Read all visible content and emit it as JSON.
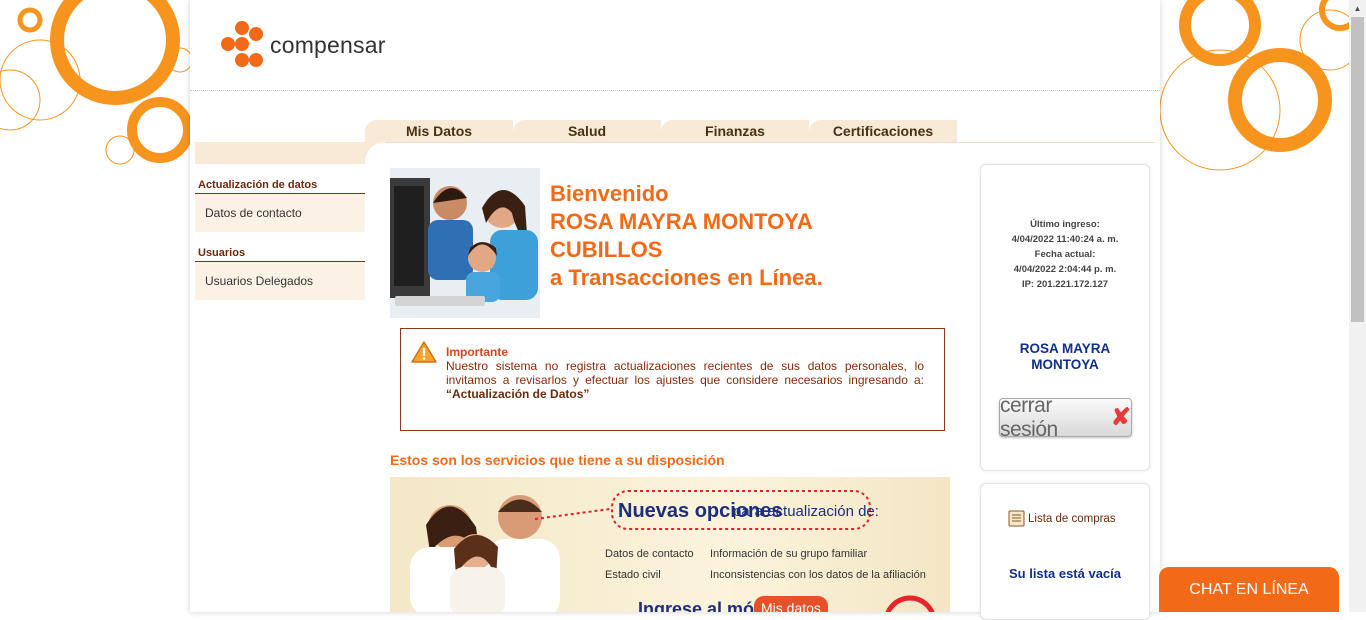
{
  "brand": {
    "name": "compensar",
    "color": "#f26a17"
  },
  "nav": {
    "tabs": [
      "Mis Datos",
      "Salud",
      "Finanzas",
      "Certificaciones"
    ]
  },
  "sidebar": {
    "sections": [
      {
        "heading": "Actualización de datos",
        "items": [
          "Datos de contacto"
        ]
      },
      {
        "heading": "Usuarios",
        "items": [
          "Usuarios Delegados"
        ]
      }
    ]
  },
  "welcome": {
    "line1": "Bienvenido",
    "line2": "ROSA MAYRA MONTOYA",
    "line3": "CUBILLOS",
    "line4": "a Transacciones en Línea."
  },
  "notice": {
    "title": "Importante",
    "body": "Nuestro sistema no registra actualizaciones recientes de sus datos personales, lo invitamos a revisarlos y efectuar los ajustes que considere necesarios ingresando a:",
    "link": "“Actualización de Datos”"
  },
  "services": {
    "title": "Estos son los servicios que tiene a su disposición",
    "banner": {
      "headline_bold": "Nuevas opciones",
      "headline_rest": "para actualización de:",
      "options": [
        "Datos de contacto",
        "Información de su grupo familiar",
        "Estado civil",
        "Inconsistencias con los datos de la afiliación"
      ],
      "cta_text": "Ingrese al módulo",
      "cta_button": "Mis datos"
    }
  },
  "session": {
    "last_login_label": "Último ingreso:",
    "last_login": "4/04/2022 11:40:24 a. m.",
    "current_date_label": "Fecha actual:",
    "current_date": "4/04/2022 2:04:44 p. m.",
    "ip": "IP: 201.221.172.127",
    "user_line1": "ROSA MAYRA",
    "user_line2": "MONTOYA",
    "logout_label": "cerrar sesión",
    "logout_icon": "x-icon"
  },
  "cart": {
    "link": "Lista de compras",
    "empty": "Su lista está vacía"
  },
  "chat": {
    "label": "CHAT EN LÍNEA"
  }
}
